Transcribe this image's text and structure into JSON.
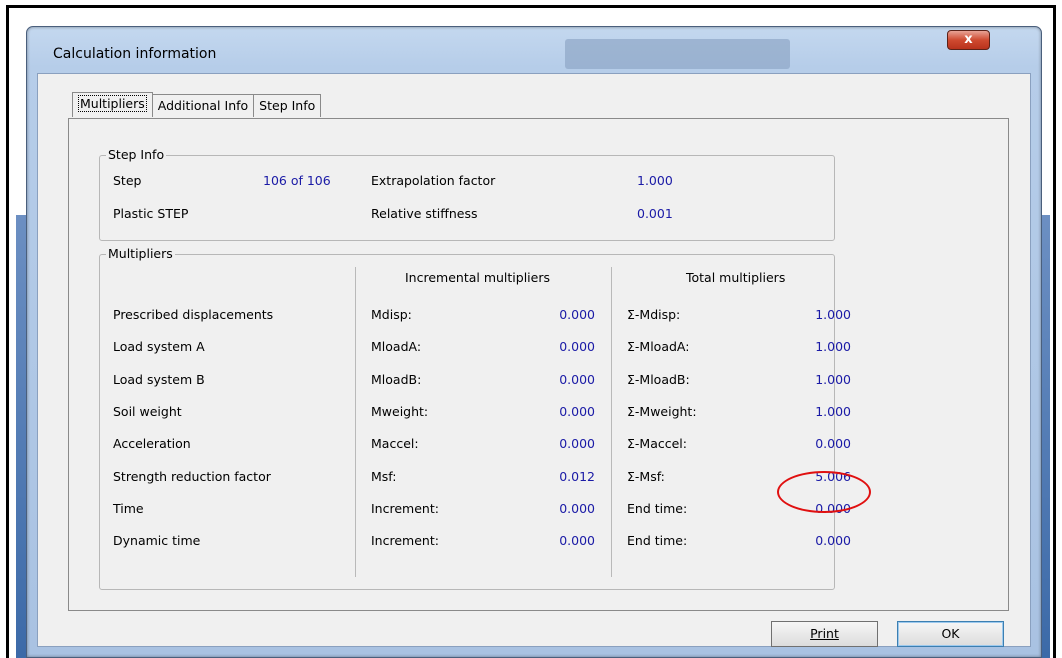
{
  "window": {
    "title": "Calculation information",
    "close_label": "x"
  },
  "tabs": [
    {
      "label": "Multipliers"
    },
    {
      "label": "Additional Info"
    },
    {
      "label": "Step Info"
    }
  ],
  "step_info": {
    "title": "Step Info",
    "step_label": "Step",
    "step_value": "106 of 106",
    "extrapolation_label": "Extrapolation factor",
    "extrapolation_value": "1.000",
    "plastic_label": "Plastic STEP",
    "stiffness_label": "Relative stiffness",
    "stiffness_value": "0.001"
  },
  "multipliers": {
    "title": "Multipliers",
    "incremental_header": "Incremental multipliers",
    "total_header": "Total multipliers",
    "rows": [
      {
        "name": "Prescribed displacements",
        "inc_label": "Mdisp:",
        "inc_value": "0.000",
        "tot_label": "Σ-Mdisp:",
        "tot_value": "1.000"
      },
      {
        "name": "Load system A",
        "inc_label": "MloadA:",
        "inc_value": "0.000",
        "tot_label": "Σ-MloadA:",
        "tot_value": "1.000"
      },
      {
        "name": "Load system B",
        "inc_label": "MloadB:",
        "inc_value": "0.000",
        "tot_label": "Σ-MloadB:",
        "tot_value": "1.000"
      },
      {
        "name": "Soil weight",
        "inc_label": "Mweight:",
        "inc_value": "0.000",
        "tot_label": "Σ-Mweight:",
        "tot_value": "1.000"
      },
      {
        "name": "Acceleration",
        "inc_label": "Maccel:",
        "inc_value": "0.000",
        "tot_label": "Σ-Maccel:",
        "tot_value": "0.000"
      },
      {
        "name": "Strength reduction factor",
        "inc_label": "Msf:",
        "inc_value": "0.012",
        "tot_label": "Σ-Msf:",
        "tot_value": "5.006"
      },
      {
        "name": "Time",
        "inc_label": "Increment:",
        "inc_value": "0.000",
        "tot_label": "End time:",
        "tot_value": "0.000"
      },
      {
        "name": "Dynamic time",
        "inc_label": "Increment:",
        "inc_value": "0.000",
        "tot_label": "End time:",
        "tot_value": "0.000"
      }
    ]
  },
  "buttons": {
    "print_label": "Print",
    "ok_label": "OK"
  },
  "colors": {
    "value_text": "#1a1aa6",
    "highlight": "#e01010"
  }
}
